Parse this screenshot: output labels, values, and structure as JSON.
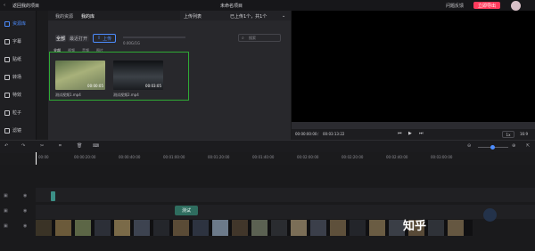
{
  "titlebar": {
    "back_label": "返回我的项目",
    "project_title": "未命名项目",
    "feedback_label": "问题反馈",
    "export_label": "立即导出"
  },
  "sidebar": {
    "items": [
      {
        "label": "资源库",
        "icon": "media-icon",
        "active": true
      },
      {
        "label": "字幕",
        "icon": "text-icon"
      },
      {
        "label": "贴纸",
        "icon": "sticker-icon"
      },
      {
        "label": "转场",
        "icon": "transition-icon"
      },
      {
        "label": "特效",
        "icon": "effect-icon"
      },
      {
        "label": "粒子",
        "icon": "particle-icon"
      },
      {
        "label": "滤镜",
        "icon": "filter-icon"
      }
    ]
  },
  "library": {
    "tabs": [
      "我的资源",
      "我的库"
    ],
    "active_tab": 1,
    "filter_all_label": "全部",
    "filter_recent_label": "最近打开",
    "upload_label": "上传",
    "storage_text": "0.00G/1G",
    "search_placeholder": "搜索",
    "type_tabs": [
      "全部",
      "视频",
      "音频",
      "图片"
    ],
    "files": [
      {
        "name": "测试视频1.mp4",
        "duration": "00:00:05"
      },
      {
        "name": "测试视频2.mp4",
        "duration": "00:03:05"
      }
    ]
  },
  "upload_panel": {
    "title": "上传列表",
    "status": "已上传1个，共1个"
  },
  "preview": {
    "current_time": "00:00:00:00",
    "total_time": "00:03:13:22",
    "speed_label": "1x",
    "ratio_label": "16:9"
  },
  "timeline": {
    "ruler_labels": [
      "00:00",
      "00:00:20:00",
      "00:00:40:00",
      "00:01:00:00",
      "00:01:20:00",
      "00:01:40:00",
      "00:02:00:00",
      "00:02:20:00",
      "00:02:40:00",
      "00:03:00:00"
    ],
    "clip_label": "测试",
    "watermark_text": "知乎"
  }
}
